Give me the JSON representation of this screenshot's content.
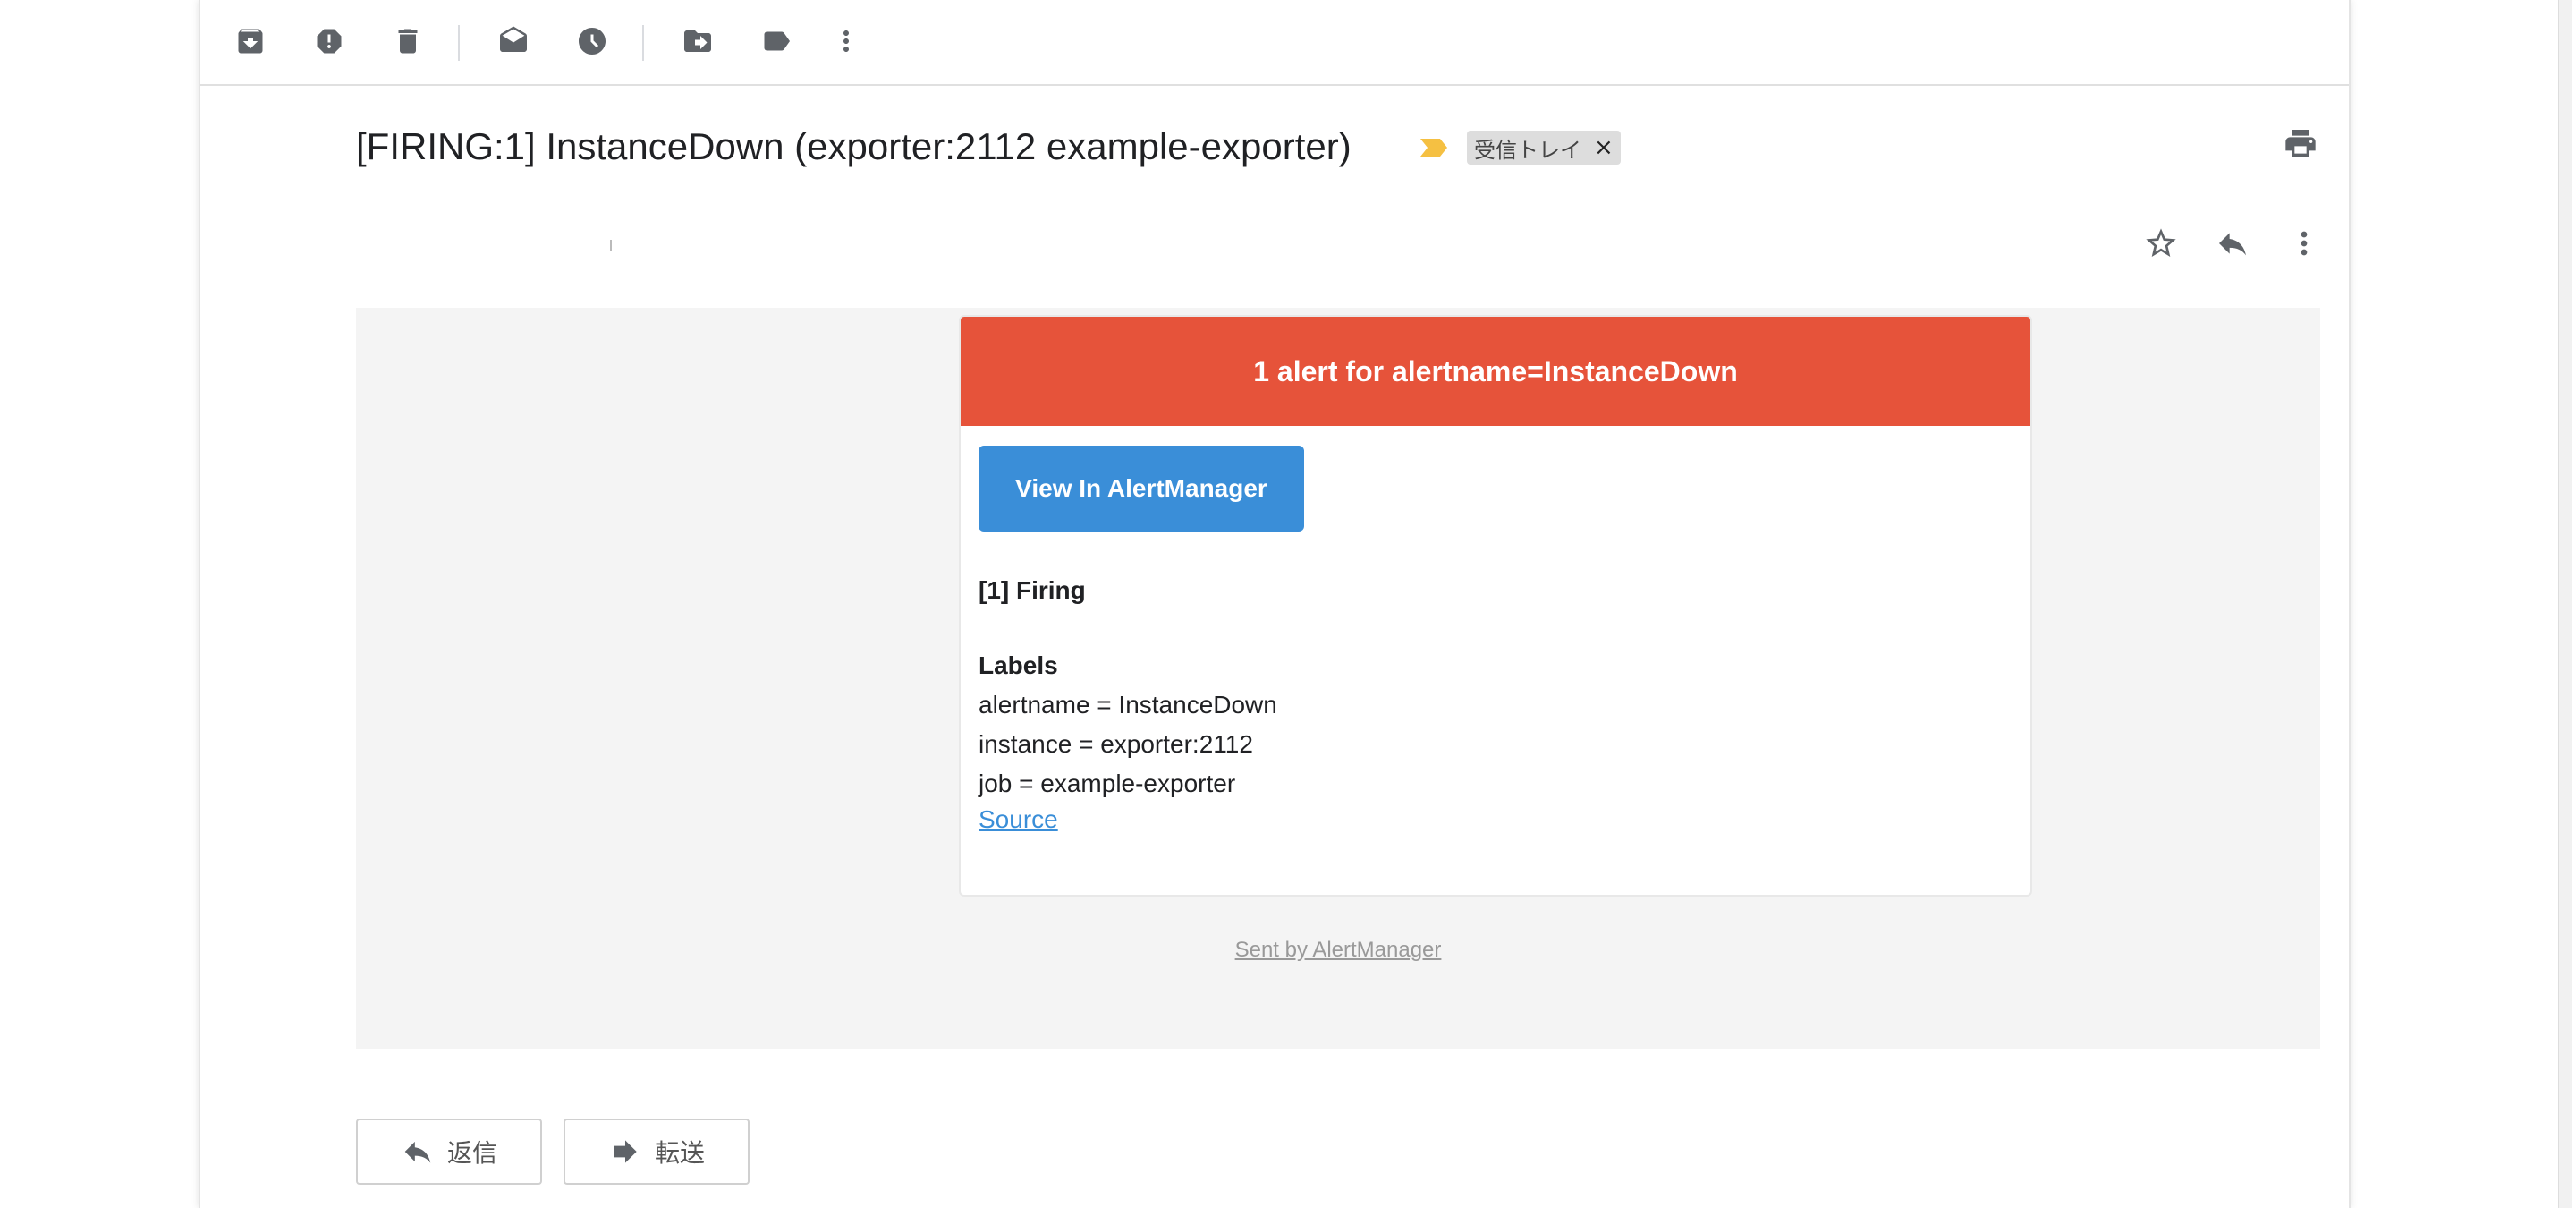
{
  "toolbar": {
    "archive": "archive-icon",
    "spam": "report-spam-icon",
    "delete": "delete-icon",
    "mark_read": "mark-as-read-icon",
    "snooze": "snooze-icon",
    "move": "move-to-icon",
    "labels": "label-icon",
    "more": "more-vert-icon"
  },
  "subject": {
    "title": "[FIRING:1] InstanceDown (exporter:2112 example-exporter)",
    "label": "受信トレイ",
    "label_remove": "×"
  },
  "email": {
    "header": "1 alert for alertname=InstanceDown",
    "button": "View In AlertManager",
    "firing": "[1] Firing",
    "labels_title": "Labels",
    "labels": [
      "alertname = InstanceDown",
      "instance = exporter:2112",
      "job = example-exporter"
    ],
    "source": "Source",
    "footer": "Sent by AlertManager"
  },
  "actions": {
    "reply": "返信",
    "forward": "転送"
  },
  "colors": {
    "alert_red": "#e6533a",
    "button_blue": "#3a8ed8",
    "importance": "#f5c042"
  }
}
